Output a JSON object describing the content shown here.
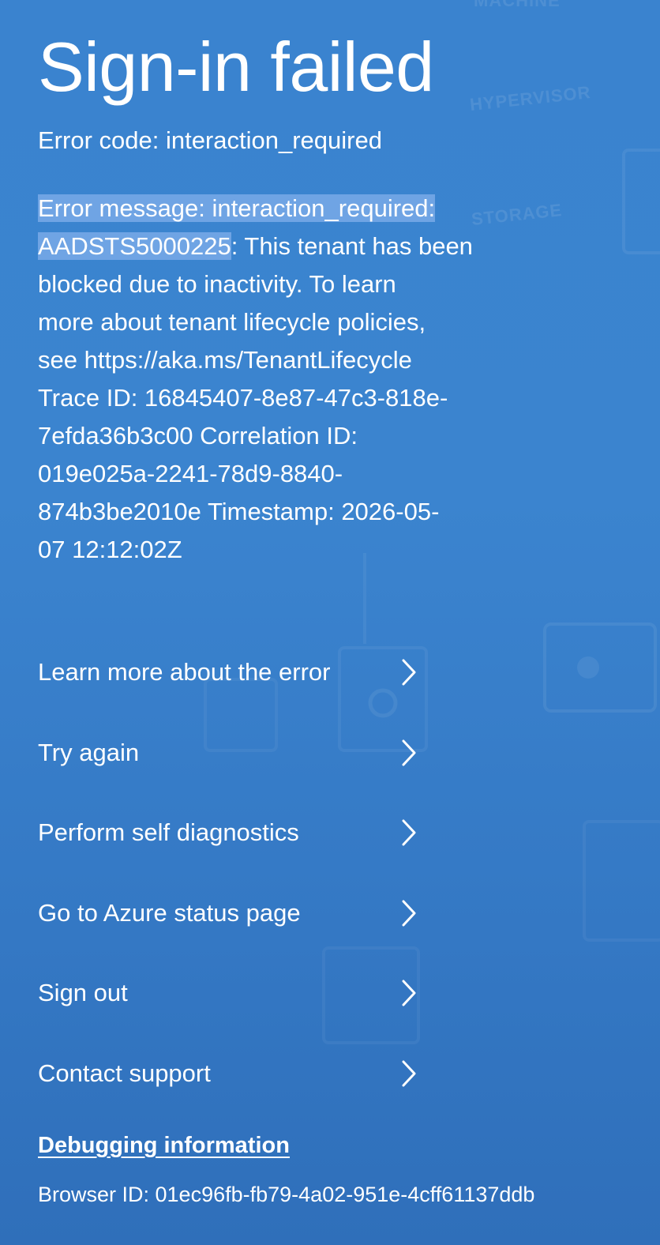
{
  "page": {
    "title": "Sign-in failed",
    "error_code": "Error code: interaction_required",
    "error_lines": [
      {
        "selected": "Error message: interaction_required: ",
        "rest": ""
      },
      {
        "selected": "AADSTS5000225",
        "rest": ": This tenant has been"
      },
      {
        "selected": "",
        "rest": "blocked due to inactivity. To learn"
      },
      {
        "selected": "",
        "rest": "more about tenant lifecycle policies,"
      },
      {
        "selected": "",
        "rest": "see https://aka.ms/TenantLifecycle"
      },
      {
        "selected": "",
        "rest": "Trace ID: 16845407-8e87-47c3-818e-"
      },
      {
        "selected": "",
        "rest": "7efda36b3c00 Correlation ID:"
      },
      {
        "selected": "",
        "rest": "019e025a-2241-78d9-8840-"
      },
      {
        "selected": "",
        "rest": "874b3be2010e Timestamp: 2026-05-"
      },
      {
        "selected": "",
        "rest": "07 12:12:02Z"
      }
    ]
  },
  "actions": [
    {
      "label": "Learn more about the error",
      "icon": "chevron-right-icon"
    },
    {
      "label": "Try again",
      "icon": "chevron-right-icon"
    },
    {
      "label": "Perform self diagnostics",
      "icon": "chevron-right-icon"
    },
    {
      "label": "Go to Azure status page",
      "icon": "chevron-right-icon"
    },
    {
      "label": "Sign out",
      "icon": "chevron-right-icon"
    },
    {
      "label": "Contact support",
      "icon": "chevron-right-icon"
    }
  ],
  "debug": {
    "link_label": "Debugging information",
    "browser_id": "Browser ID: 01ec96fb-fb79-4a02-951e-4cff61137ddb"
  },
  "background_words": [
    "MACHINE",
    "HYPERVISOR",
    "STORAGE"
  ],
  "colors": {
    "background": "#3a83cf",
    "text": "#ffffff",
    "selection": "#82afeb"
  }
}
